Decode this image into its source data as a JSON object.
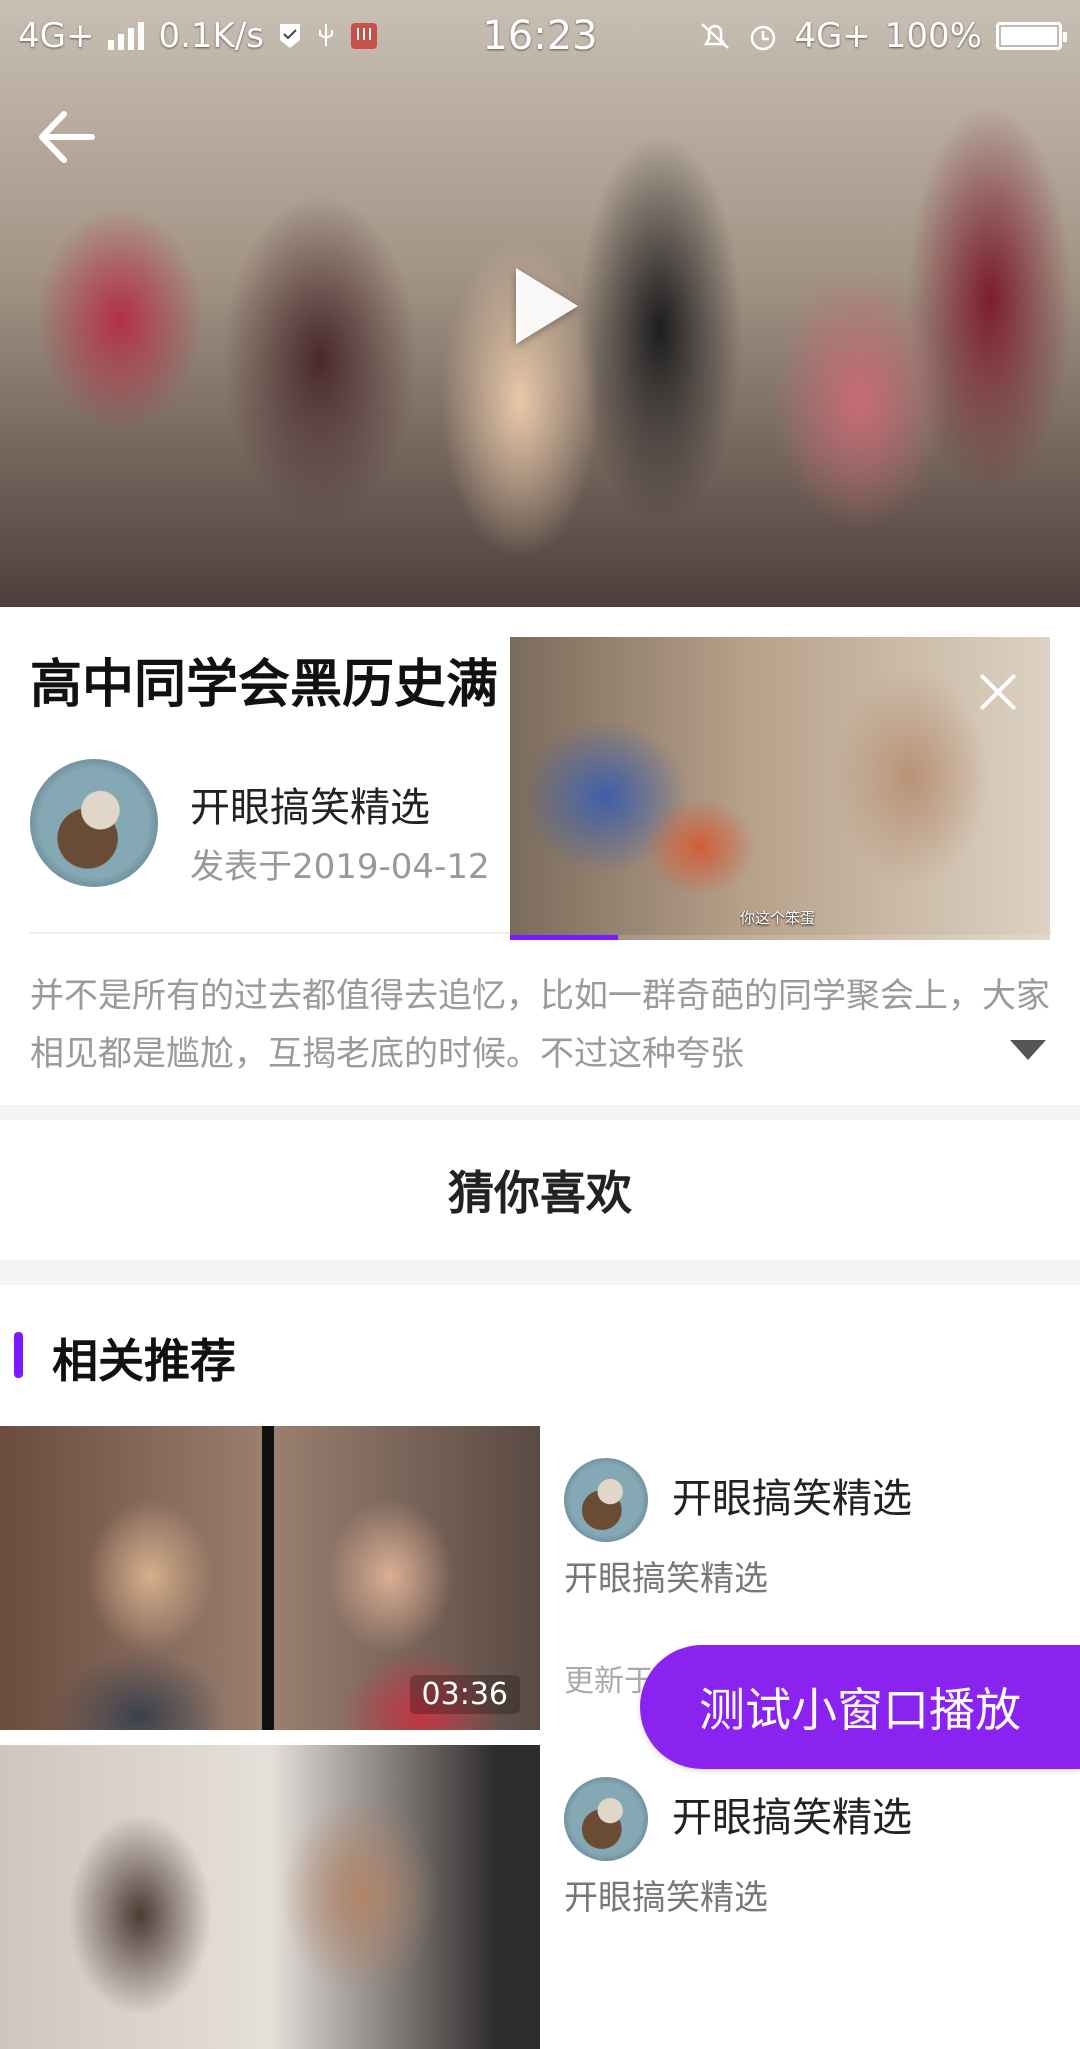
{
  "status_bar": {
    "left_text": "4G+",
    "speed": "0.1K/s",
    "time": "16:23",
    "network_right": "4G+",
    "battery": "100%"
  },
  "video": {
    "title": "高中同学会黑历史满",
    "author": "开眼搞笑精选",
    "published": "发表于2019-04-12",
    "description": "并不是所有的过去都值得去追忆，比如一群奇葩的同学聚会上，大家相见都是尴尬，互揭老底的时候。不过这种夸张",
    "mini_player_subtitle": "你这个笨蛋"
  },
  "sections": {
    "guess": "猜你喜欢",
    "related": "相关推荐"
  },
  "related_items": [
    {
      "author": "开眼搞笑精选",
      "subtitle": "开眼搞笑精选",
      "updated": "更新于2019-04-12",
      "duration": "03:36"
    },
    {
      "author": "开眼搞笑精选",
      "subtitle": "开眼搞笑精选"
    }
  ],
  "floating_button": {
    "label": "测试小窗口播放"
  },
  "colors": {
    "accent": "#7b19ff",
    "floating_button": "#8b23f0"
  },
  "icons": {
    "back": "arrow-left-icon",
    "play": "play-icon",
    "close": "close-icon",
    "expand": "triangle-down-icon",
    "alarm": "alarm-icon",
    "mute": "mute-icon"
  }
}
